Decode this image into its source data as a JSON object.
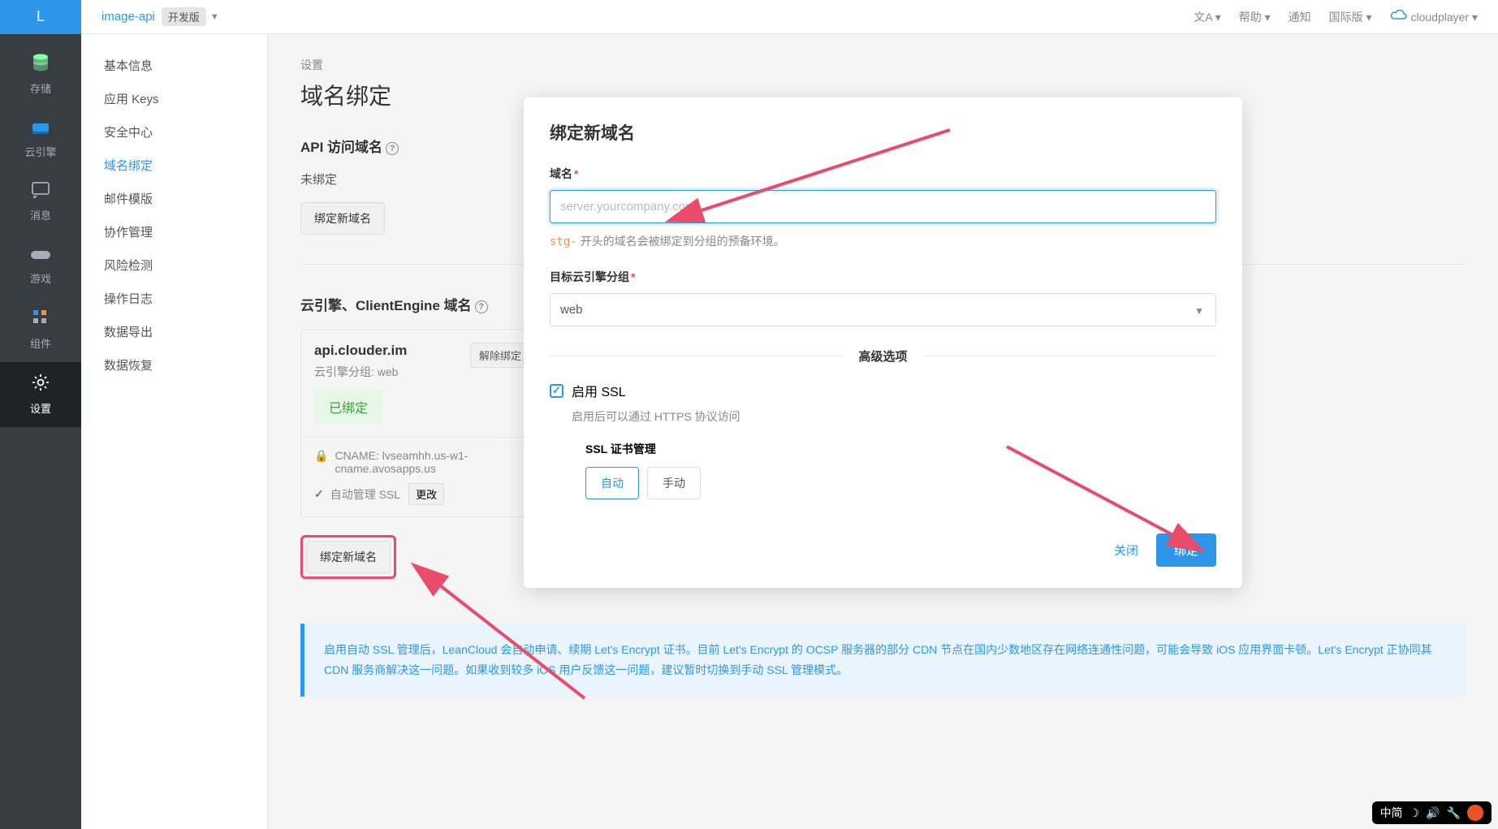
{
  "topbar": {
    "logo": "L",
    "project": "image-api",
    "version": "开发版",
    "lang_label": "文A",
    "help": "帮助",
    "notify": "通知",
    "region": "国际版",
    "user": "cloudplayer"
  },
  "rail": {
    "storage": "存储",
    "engine": "云引擎",
    "message": "消息",
    "game": "游戏",
    "component": "组件",
    "settings": "设置"
  },
  "submenu": {
    "basic": "基本信息",
    "keys": "应用 Keys",
    "security": "安全中心",
    "domain": "域名绑定",
    "email": "邮件模版",
    "collab": "协作管理",
    "risk": "风险检测",
    "oplog": "操作日志",
    "export": "数据导出",
    "restore": "数据恢复"
  },
  "main": {
    "breadcrumb": "设置",
    "title": "域名绑定",
    "api_section": "API 访问域名",
    "unbound": "未绑定",
    "bind_new_btn": "绑定新域名",
    "engine_section": "云引擎、ClientEngine 域名",
    "card": {
      "host": "api.clouder.im",
      "unbind": "解除绑定",
      "group": "云引擎分组: web",
      "bound": "已绑定",
      "cname": "CNAME: lvseamhh.us-w1-cname.avosapps.us",
      "ssl_auto": "自动管理 SSL",
      "change": "更改"
    },
    "bind_new_btn2": "绑定新域名",
    "info": "启用自动 SSL 管理后，LeanCloud 会自动申请、续期 Let's Encrypt 证书。目前 Let's Encrypt 的 OCSP 服务器的部分 CDN 节点在国内少数地区存在网络连通性问题，可能会导致 iOS 应用界面卡顿。Let's Encrypt 正协同其 CDN 服务商解决这一问题。如果收到较多 iOS 用户反馈这一问题，建议暂时切换到手动 SSL 管理模式。"
  },
  "modal": {
    "title": "绑定新域名",
    "domain_label": "域名",
    "domain_placeholder": "server.yourcompany.com",
    "hint_prefix": "stg-",
    "hint_text": " 开头的域名会被绑定到分组的预备环境。",
    "target_label": "目标云引擎分组",
    "target_value": "web",
    "advanced": "高级选项",
    "enable_ssl": "启用 SSL",
    "ssl_hint": "启用后可以通过 HTTPS 协议访问",
    "ssl_mgmt": "SSL 证书管理",
    "auto": "自动",
    "manual": "手动",
    "close": "关闭",
    "bind": "绑定"
  },
  "os": {
    "ime": "中简"
  }
}
